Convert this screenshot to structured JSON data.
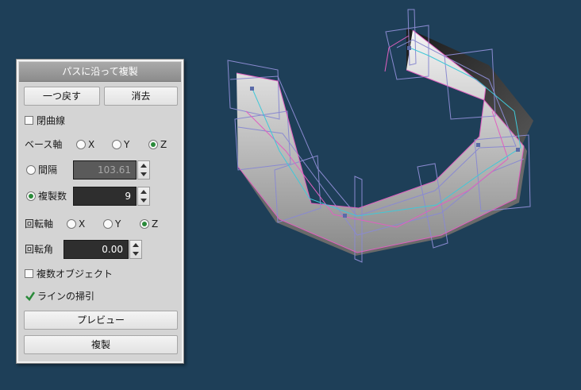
{
  "panel": {
    "title": "パスに沿って複製",
    "undo_label": "一つ戻す",
    "delete_label": "消去",
    "closed_curve_label": "閉曲線",
    "closed_curve_checked": false,
    "base_axis": {
      "label": "ベース軸",
      "options": [
        "X",
        "Y",
        "Z"
      ],
      "selected": "Z"
    },
    "spacing": {
      "label": "間隔",
      "value": "103.61",
      "selected": false
    },
    "copies": {
      "label": "複製数",
      "value": "9",
      "selected": true
    },
    "rotation_axis": {
      "label": "回転軸",
      "options": [
        "X",
        "Y",
        "Z"
      ],
      "selected": "Z"
    },
    "rotation_angle": {
      "label": "回転角",
      "value": "0.00"
    },
    "multi_object_label": "複数オブジェクト",
    "multi_object_checked": false,
    "sweep_line_label": "ラインの掃引",
    "sweep_line_checked": true,
    "preview_label": "プレビュー",
    "duplicate_label": "複製"
  },
  "colors": {
    "viewport_bg": "#1e3f58",
    "accent_green": "#2a8a3a"
  }
}
